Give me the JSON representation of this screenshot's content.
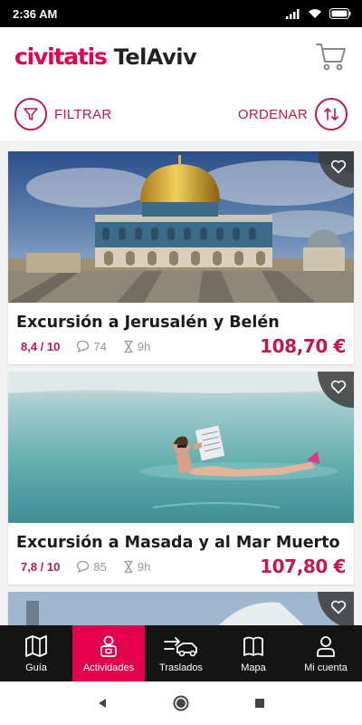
{
  "status": {
    "time": "2:36 AM"
  },
  "header": {
    "logo": "civitatis",
    "city": "TelAviv"
  },
  "toolbar": {
    "filter_label": "FILTRAR",
    "sort_label": "ORDENAR"
  },
  "activities": [
    {
      "title": "Excursión a Jerusalén y Belén",
      "rating": "8,4 / 10",
      "comments": "74",
      "duration": "9h",
      "price": "108,70 €",
      "image": "dome-of-the-rock"
    },
    {
      "title": "Excursión a Masada y al Mar Muerto",
      "rating": "7,8 / 10",
      "comments": "85",
      "duration": "9h",
      "price": "107,80 €",
      "image": "dead-sea-floating"
    }
  ],
  "bottom_nav": [
    {
      "label": "Guía",
      "icon": "map-book-icon"
    },
    {
      "label": "Actividades",
      "icon": "activities-icon",
      "active": true
    },
    {
      "label": "Traslados",
      "icon": "transfer-car-icon"
    },
    {
      "label": "Mapa",
      "icon": "map-icon"
    },
    {
      "label": "Mi cuenta",
      "icon": "user-icon"
    }
  ],
  "colors": {
    "brand": "#e5004e",
    "accent": "#c4174f",
    "nav_bg": "#141414"
  }
}
